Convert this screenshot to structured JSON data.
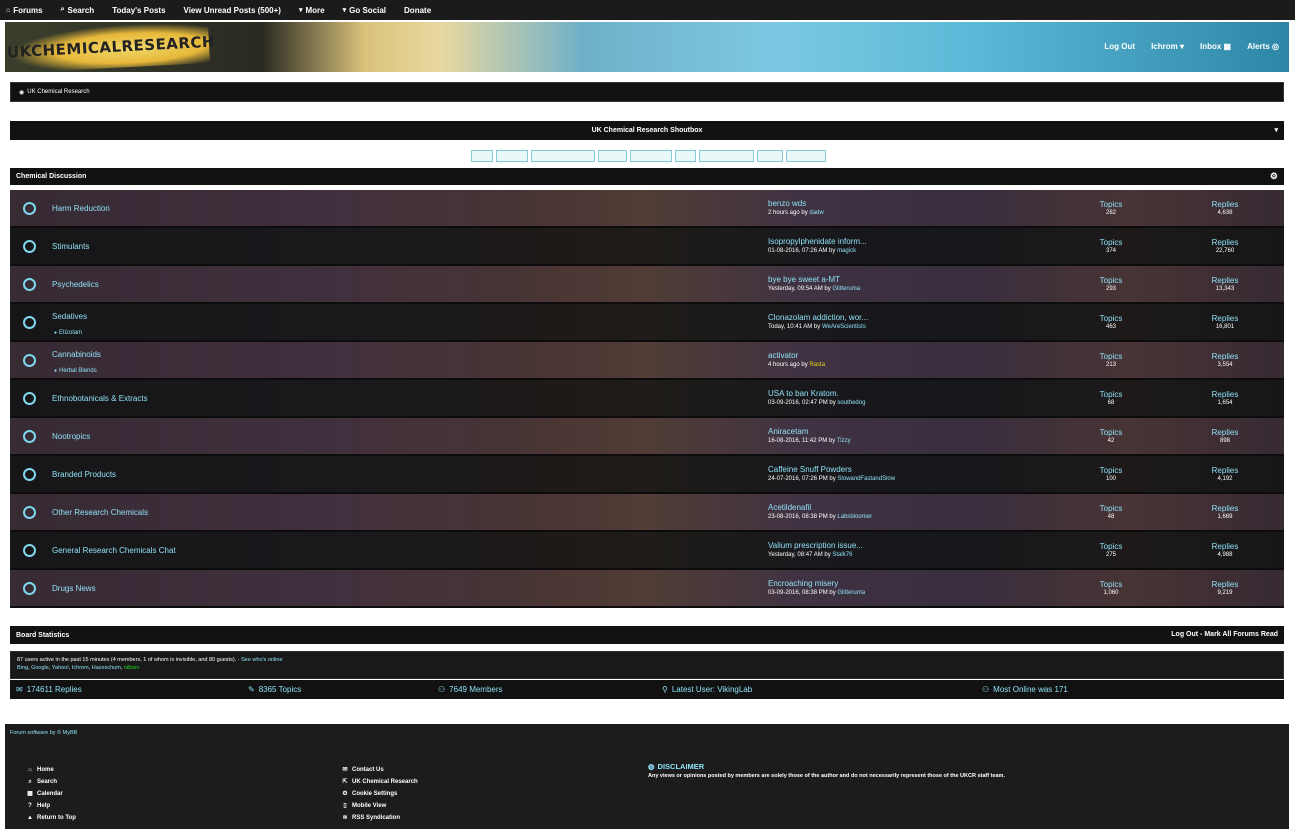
{
  "topnav": {
    "items": [
      {
        "icon": "home-icon",
        "glyph": "⌂",
        "label": "Forums"
      },
      {
        "icon": "search-icon",
        "glyph": "⌕",
        "label": "Search"
      },
      {
        "icon": "",
        "glyph": "",
        "label": "Today's Posts"
      },
      {
        "icon": "",
        "glyph": "",
        "label": "View Unread Posts (500+)"
      },
      {
        "icon": "chevron-down-icon",
        "glyph": "▾",
        "label": "More"
      },
      {
        "icon": "chevron-down-icon",
        "glyph": "▾",
        "label": "Go Social"
      },
      {
        "icon": "",
        "glyph": "",
        "label": "Donate"
      }
    ]
  },
  "banner": {
    "logo_text": "UKCHEMICALRESEARCH",
    "user_menu": [
      "Log Out",
      "Ichrom ▾",
      "Inbox ▦",
      "Alerts ◎"
    ]
  },
  "breadcrumb": {
    "label": "UK Chemical Research"
  },
  "shoutbox": {
    "title": "UK Chemical Research Shoutbox"
  },
  "category": {
    "title": "Chemical Discussion"
  },
  "forums": [
    {
      "name": "Harm Reduction",
      "sub": "",
      "last_title": "benzo wds",
      "last_time": "2 hours ago by",
      "last_user": "dadw",
      "last_user_gold": false,
      "topics": "282",
      "replies": "4,638"
    },
    {
      "name": "Stimulants",
      "sub": "",
      "last_title": "Isopropylphenidate inform...",
      "last_time": "01-08-2016, 07:26 AM by",
      "last_user": "magick",
      "last_user_gold": false,
      "topics": "374",
      "replies": "22,760"
    },
    {
      "name": "Psychedelics",
      "sub": "",
      "last_title": "bye bye sweet a-MT",
      "last_time": "Yesterday, 09:54 AM by",
      "last_user": "Glitteruma",
      "last_user_gold": false,
      "topics": "293",
      "replies": "13,343"
    },
    {
      "name": "Sedatives",
      "sub": "Etizolam",
      "last_title": "Clonazolam addiction, wor...",
      "last_time": "Today, 10:41 AM by",
      "last_user": "WeAreScientists",
      "last_user_gold": false,
      "topics": "463",
      "replies": "16,801"
    },
    {
      "name": "Cannabinoids",
      "sub": "Herbal Blends",
      "last_title": "activator",
      "last_time": "4 hours ago by",
      "last_user": "Rasta",
      "last_user_gold": true,
      "topics": "213",
      "replies": "3,554"
    },
    {
      "name": "Ethnobotanicals & Extracts",
      "sub": "",
      "last_title": "USA to ban Kratom.",
      "last_time": "03-09-2016, 02:47 PM by",
      "last_user": "southedog",
      "last_user_gold": false,
      "topics": "68",
      "replies": "1,654"
    },
    {
      "name": "Nootropics",
      "sub": "",
      "last_title": "Aniracetam",
      "last_time": "16-08-2016, 11:42 PM by",
      "last_user": "Tizzy",
      "last_user_gold": false,
      "topics": "42",
      "replies": "898"
    },
    {
      "name": "Branded Products",
      "sub": "",
      "last_title": "Caffeine Snuff Powders",
      "last_time": "24-07-2016, 07:26 PM by",
      "last_user": "SlowandFastandSlow",
      "last_user_gold": false,
      "topics": "100",
      "replies": "4,192"
    },
    {
      "name": "Other Research Chemicals",
      "sub": "",
      "last_title": "Acetildenafil",
      "last_time": "23-08-2016, 08:38 PM by",
      "last_user": "Labsbloomer",
      "last_user_gold": false,
      "topics": "48",
      "replies": "1,669"
    },
    {
      "name": "General Research Chemicals Chat",
      "sub": "",
      "last_title": "Valium prescription issue...",
      "last_time": "Yesterday, 08:47 AM by",
      "last_user": "Stalk76",
      "last_user_gold": false,
      "topics": "275",
      "replies": "4,988"
    },
    {
      "name": "Drugs News",
      "sub": "",
      "last_title": "Encroaching misery",
      "last_time": "03-09-2016, 08:38 PM by",
      "last_user": "Glitteruma",
      "last_user_gold": false,
      "topics": "1,060",
      "replies": "9,219"
    }
  ],
  "labels": {
    "topics": "Topics",
    "replies": "Replies"
  },
  "board_stats": {
    "title": "Board Statistics",
    "logout": "Log Out",
    "separator": " - ",
    "mark_read": "Mark All Forums Read",
    "online_text": "87 users active in the past 15 minutes (4 members, 1 of whom is invisible, and 80 guests).",
    "see_online": " - See who's online",
    "bots": [
      {
        "name": "Bing",
        "green": false
      },
      {
        "name": "Google",
        "green": false
      },
      {
        "name": "Yahoo!",
        "green": false
      },
      {
        "name": "Ichrom",
        "green": false
      },
      {
        "name": "Hazeschum",
        "green": false
      },
      {
        "name": "nilbsin",
        "green": true
      }
    ],
    "totals": [
      {
        "icon": "comments-icon",
        "glyph": "✉",
        "label": "174611 Replies"
      },
      {
        "icon": "topics-icon",
        "glyph": "✎",
        "label": "8365 Topics"
      },
      {
        "icon": "members-icon",
        "glyph": "⚇",
        "label": "7649 Members"
      },
      {
        "icon": "user-icon",
        "glyph": "⚲",
        "label": "Latest User: VikingLab"
      },
      {
        "icon": "online-icon",
        "glyph": "⚇",
        "label": "Most Online was 171"
      }
    ]
  },
  "footer": {
    "powered": "Forum software by © MyBB",
    "col1": [
      {
        "icon": "home-icon",
        "glyph": "⌂",
        "label": "Home"
      },
      {
        "icon": "search-icon",
        "glyph": "⌕",
        "label": "Search"
      },
      {
        "icon": "calendar-icon",
        "glyph": "▦",
        "label": "Calendar"
      },
      {
        "icon": "help-icon",
        "glyph": "?",
        "label": "Help"
      },
      {
        "icon": "arrow-up-icon",
        "glyph": "▲",
        "label": "Return to Top"
      }
    ],
    "col2": [
      {
        "icon": "mail-icon",
        "glyph": "✉",
        "label": "Contact Us"
      },
      {
        "icon": "link-icon",
        "glyph": "⇱",
        "label": "UK Chemical Research"
      },
      {
        "icon": "gear-icon",
        "glyph": "⚙",
        "label": "Cookie Settings"
      },
      {
        "icon": "mobile-icon",
        "glyph": "▯",
        "label": "Mobile View"
      },
      {
        "icon": "rss-icon",
        "glyph": "≋",
        "label": "RSS Syndication"
      }
    ],
    "disclaimer_title": "DISCLAIMER",
    "disclaimer_text": "Any views or opinions posted by members are solely those of the author and do not necessarily represent those of the UKCR staff team."
  }
}
